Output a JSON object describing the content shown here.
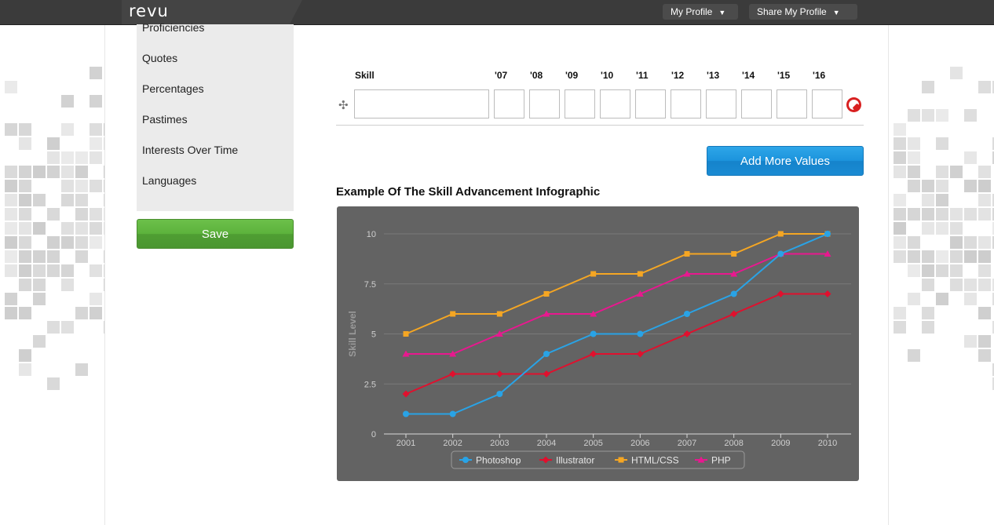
{
  "header": {
    "logo_text": "revu",
    "my_profile_label": "My Profile",
    "share_profile_label": "Share My Profile",
    "caret_icon": "▼"
  },
  "sidebar": {
    "items": [
      {
        "label": "Proficiencies"
      },
      {
        "label": "Quotes"
      },
      {
        "label": "Percentages"
      },
      {
        "label": "Pastimes"
      },
      {
        "label": "Interests Over Time"
      },
      {
        "label": "Languages"
      }
    ],
    "save_label": "Save"
  },
  "skill_form": {
    "skill_header": "Skill",
    "year_headers": [
      "'07",
      "'08",
      "'09",
      "'10",
      "'11",
      "'12",
      "'13",
      "'14",
      "'15",
      "'16"
    ],
    "skill_value": "",
    "year_values": [
      "",
      "",
      "",
      "",
      "",
      "",
      "",
      "",
      "",
      ""
    ],
    "drag_icon": "move-icon",
    "delete_icon": "delete-icon",
    "add_label": "Add More Values"
  },
  "example": {
    "title": "Example Of The Skill Advancement Infographic"
  },
  "colors": {
    "photoshop": "#29a3e6",
    "illustrator": "#e0102e",
    "html_css": "#f5a623",
    "php": "#e8188f",
    "chart_bg": "#636363",
    "save_green": "#5cb23c",
    "add_blue": "#1c93dc"
  },
  "chart_data": {
    "type": "line",
    "title": "",
    "xlabel": "",
    "ylabel": "Skill Level",
    "x": [
      "2001",
      "2002",
      "2003",
      "2004",
      "2005",
      "2006",
      "2007",
      "2008",
      "2009",
      "2010"
    ],
    "ylim": [
      0,
      10
    ],
    "yticks": [
      "0",
      "2.5",
      "5",
      "7.5",
      "10"
    ],
    "grid": true,
    "legend_position": "bottom",
    "series": [
      {
        "name": "Photoshop",
        "color": "#29a3e6",
        "marker": "circle",
        "values": [
          1,
          1,
          2,
          4,
          5,
          5,
          6,
          7,
          9,
          10
        ]
      },
      {
        "name": "Illustrator",
        "color": "#e0102e",
        "marker": "diamond",
        "values": [
          2,
          3,
          3,
          3,
          4,
          4,
          5,
          6,
          7,
          7
        ]
      },
      {
        "name": "HTML/CSS",
        "color": "#f5a623",
        "marker": "square",
        "values": [
          5,
          6,
          6,
          7,
          8,
          8,
          9,
          9,
          10,
          10
        ]
      },
      {
        "name": "PHP",
        "color": "#e8188f",
        "marker": "triangle",
        "values": [
          4,
          4,
          5,
          6,
          6,
          7,
          8,
          8,
          9,
          9
        ]
      }
    ]
  }
}
